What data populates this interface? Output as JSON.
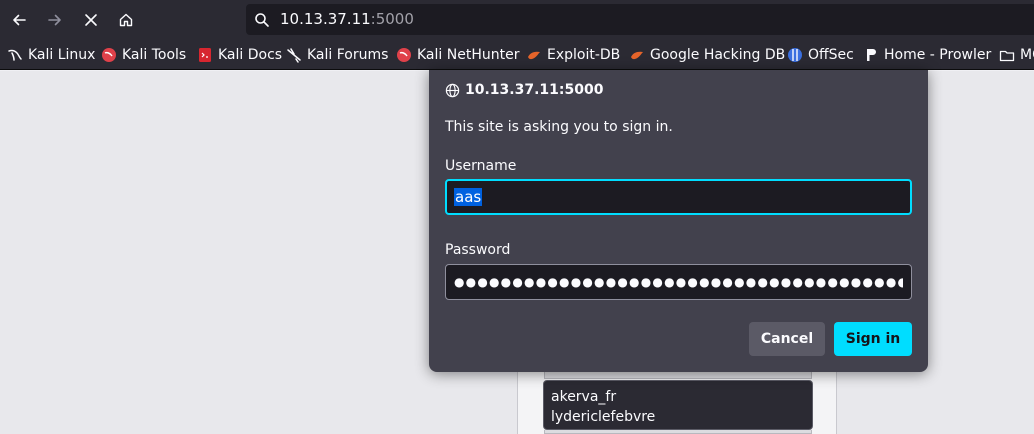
{
  "browser": {
    "url": {
      "host": "10.13.37.11",
      "port": ":5000"
    },
    "bookmarks": [
      {
        "label": "Kali Linux",
        "icon": "kali-dragon-icon"
      },
      {
        "label": "Kali Tools",
        "icon": "kali-tools-icon"
      },
      {
        "label": "Kali Docs",
        "icon": "kali-docs-icon"
      },
      {
        "label": "Kali Forums",
        "icon": "kali-forums-icon"
      },
      {
        "label": "Kali NetHunter",
        "icon": "kali-nethunter-icon"
      },
      {
        "label": "Exploit-DB",
        "icon": "exploit-db-icon"
      },
      {
        "label": "Google Hacking DB",
        "icon": "ghdb-icon"
      },
      {
        "label": "OffSec",
        "icon": "offsec-icon"
      },
      {
        "label": "Home - Prowler",
        "icon": "prowler-icon"
      },
      {
        "label": "MC",
        "icon": "folder-icon"
      }
    ]
  },
  "auth_dialog": {
    "origin": "10.13.37.11:5000",
    "message": "This site is asking you to sign in.",
    "username_label": "Username",
    "username_value": "aas",
    "password_label": "Password",
    "password_mask": "●●●●●●●●●●●●●●●●●●●●●●●●●●●●●●●●●●●●●●●",
    "cancel_label": "Cancel",
    "signin_label": "Sign in"
  },
  "page": {
    "card_lines": [
      "akerva_fr",
      "lydericlefebvre"
    ]
  },
  "colors": {
    "accent": "#00ddff",
    "selection": "#0061e0",
    "dialog_bg": "#42414d",
    "chrome_bg": "#2b2a33"
  }
}
